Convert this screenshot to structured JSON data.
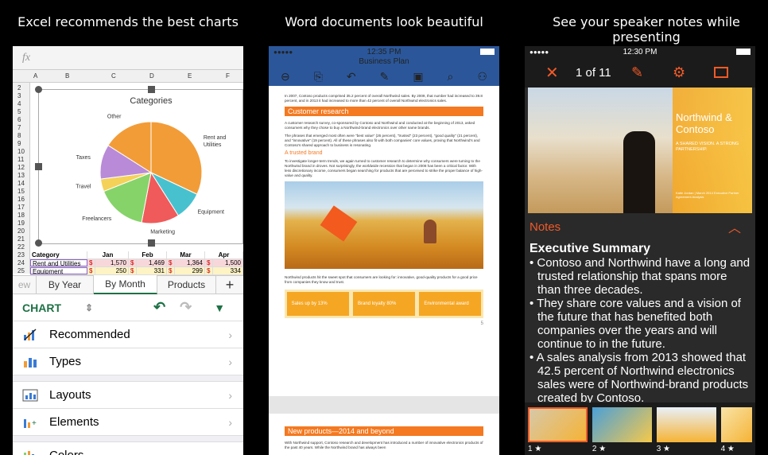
{
  "captions": {
    "excel": "Excel recommends the best charts",
    "word": "Word documents look beautiful",
    "ppt": "See your speaker notes while presenting"
  },
  "excel": {
    "fx": "fx",
    "columns": [
      "A",
      "B",
      "C",
      "D",
      "E",
      "F"
    ],
    "rows": [
      "2",
      "3",
      "4",
      "5",
      "6",
      "7",
      "8",
      "9",
      "10",
      "11",
      "12",
      "13",
      "14",
      "15",
      "16",
      "17",
      "18",
      "19",
      "20",
      "21",
      "22",
      "23",
      "24",
      "25"
    ],
    "chart": {
      "title": "Categories",
      "slices": [
        {
          "label": "Rent and Utilities",
          "value": 32,
          "color": "#f29c38"
        },
        {
          "label": "Equipment",
          "value": 9,
          "color": "#48c1cf"
        },
        {
          "label": "Marketing",
          "value": 12,
          "color": "#f05a5a"
        },
        {
          "label": "Freelancers",
          "value": 16,
          "color": "#86d36a"
        },
        {
          "label": "Travel",
          "value": 4,
          "color": "#f4d158"
        },
        {
          "label": "Taxes",
          "value": 11,
          "color": "#b98ad8"
        },
        {
          "label": "Other",
          "value": 16,
          "color": "#f29c38"
        }
      ]
    },
    "table": {
      "header": [
        "Category",
        "Jan",
        "Feb",
        "Mar",
        "Apr"
      ],
      "rows": [
        [
          "Rent and Utilities",
          "$",
          "1,570",
          "$",
          "1,469",
          "$",
          "1,364",
          "$",
          "1,500"
        ],
        [
          "Equipment",
          "$",
          "250",
          "$",
          "331",
          "$",
          "299",
          "$",
          "334"
        ]
      ]
    },
    "tabs": [
      "ew",
      "By Year",
      "By Month",
      "Products",
      "+"
    ],
    "chart_label": "CHART",
    "menu": [
      "Recommended",
      "Types",
      "Layouts",
      "Elements",
      "Colors"
    ]
  },
  "word": {
    "time": "12:35 PM",
    "title": "Business Plan",
    "p1": "In 2007, Contoso products comprised 35.2 percent of overall Northwind sales. By 2009, that number had increased to 39.8 percent, and in 2013 it had increased to more than 42 percent of overall Northwind electronics sales.",
    "h1": "Customer research",
    "p2": "A customer research survey, co-sponsored by Contoso and Northwind and conducted at the beginning of 2013, asked consumers why they chose to buy a Northwind-brand electronics over other name brands.",
    "p3": "The phrases that emerged most often were \"best value\" (26 percent), \"trusted\" (23 percent), \"good quality\" (21 percent), and \"innovative\" (19 percent). All of these phrases also fit with both companies' core values, proving that Northwind's and Contoso's shared approach to business is resonating.",
    "sub1": "A trusted brand",
    "p4": "To investigate longer-term trends, we again turned to customer research to determine why consumers were turning to the Northwind brand in droves. Not surprisingly, the worldwide recession that began in 2008 has been a critical factor. With less discretionary income, consumers began searching for products that are perceived to strike the proper balance of high-value and quality.",
    "p5": "Northwind products hit the sweet spot that consumers are looking for: innovative, good-quality products for a good price from companies they know and trust.",
    "info": [
      "Sales up by 13%",
      "Brand loyalty 80%",
      "Environmental award"
    ],
    "page_num": "5",
    "h2": "New products—2014 and beyond",
    "p6": "With Northwind support, Contoso research and development has introduced a number of innovative electronics products of the past 40 years. While the Northwind brand has always been"
  },
  "ppt": {
    "time": "12:30 PM",
    "counter": "1 of 11",
    "slide_title": "Northwind & Contoso",
    "slide_sub": "A SHARED VISION. A STRONG PARTNERSHIP.",
    "slide_footer": "Katie Jordan | March 2014 Executive Partner Agreement Analysis",
    "notes_label": "Notes",
    "notes_head": "Executive Summary",
    "bullets": [
      "Contoso and Northwind have a long and trusted relationship that spans more than three decades.",
      "They share core values and a vision of the future that has benefited both companies over the years and will continue to in the future.",
      "A sales analysis from 2013 showed that 42.5 percent of Northwind electronics sales were of Northwind-brand products created by Contoso."
    ],
    "thumbs": [
      "1 ★",
      "2 ★",
      "3 ★",
      "4 ★"
    ]
  }
}
